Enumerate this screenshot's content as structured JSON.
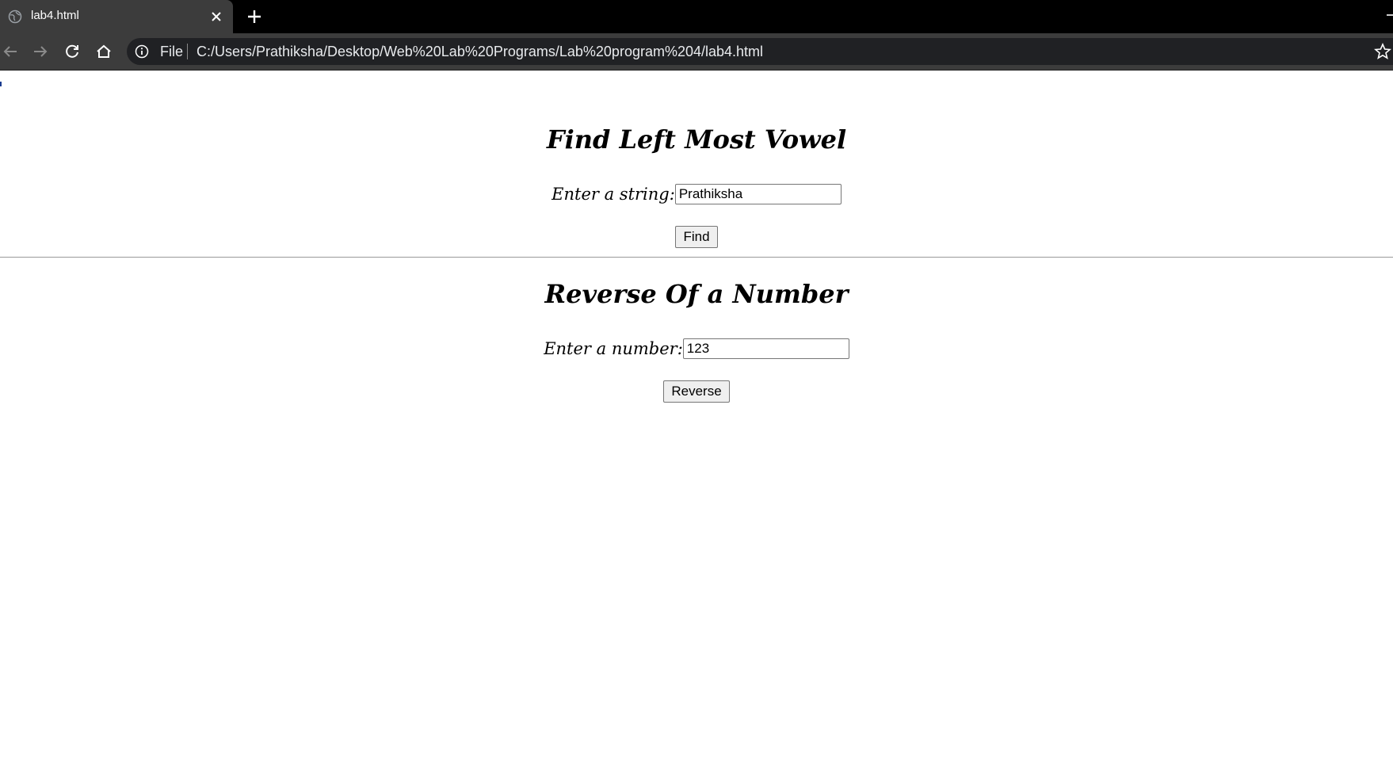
{
  "browser": {
    "tab": {
      "title": "lab4.html"
    },
    "address_bar": {
      "scheme_label": "File",
      "url": "C:/Users/Prathiksha/Desktop/Web%20Lab%20Programs/Lab%20program%204/lab4.html"
    },
    "icons": [
      "globe-icon",
      "close-icon",
      "new-tab-icon",
      "back-icon",
      "forward-icon",
      "reload-icon",
      "home-icon",
      "info-icon",
      "star-icon"
    ]
  },
  "page": {
    "vowel_section": {
      "heading": "Find Left Most Vowel",
      "input_label": "Enter a string:",
      "input_value": "Prathiksha",
      "button_label": "Find"
    },
    "reverse_section": {
      "heading": "Reverse Of a Number",
      "input_label": "Enter a number:",
      "input_value": "123",
      "button_label": "Reverse"
    }
  },
  "colors": {
    "tabbar_bg": "#000000",
    "toolbar_bg": "#3c3c3c",
    "omnibox_bg": "#202124",
    "page_bg": "#ffffff"
  }
}
